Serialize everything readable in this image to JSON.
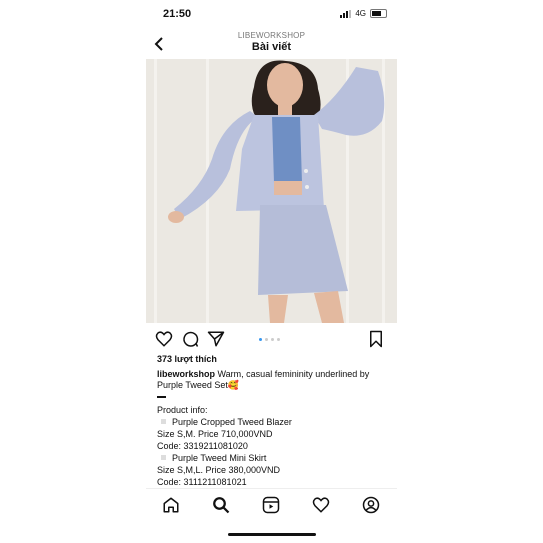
{
  "status_bar": {
    "time": "21:50",
    "network": "4G"
  },
  "header": {
    "account": "LIBEWORKSHOP",
    "title": "Bài viết"
  },
  "carousel": {
    "current": 1,
    "total": 4
  },
  "post": {
    "likes": "373 lượt thích",
    "username": "libeworkshop",
    "caption": " Warm, casual femininity underlined by Purple Tweed Set🥰",
    "info_heading": "Product info:",
    "item1_name": "Purple Cropped Tweed Blazer",
    "item1_size_price": "Size S,M. Price 710,000VND",
    "item1_code": "Code: 3319211081020",
    "item2_name": "Purple Tweed Mini Skirt",
    "item2_size_price": "Size S,M,L. Price 380,000VND",
    "item2_code": "Code: 3111211081021"
  },
  "icons": {
    "back": "chevron-left-icon",
    "like": "heart-icon",
    "comment": "comment-icon",
    "share": "send-icon",
    "save": "bookmark-icon",
    "home": "home-icon",
    "search": "search-icon",
    "reels": "reels-icon",
    "activity": "heart-icon",
    "profile": "profile-icon"
  },
  "colors": {
    "accent": "#3897f0",
    "text": "#111111",
    "muted": "#777777"
  }
}
